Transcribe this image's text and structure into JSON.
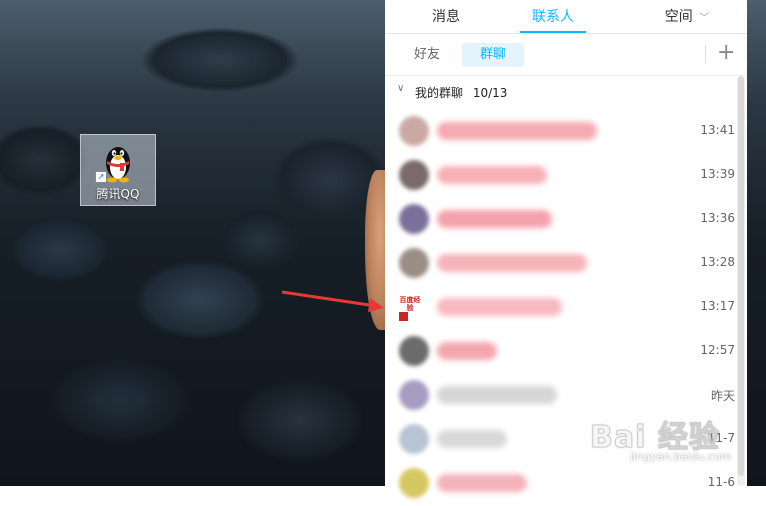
{
  "desktop": {
    "icon_label": "腾讯QQ"
  },
  "qq": {
    "tabs": [
      {
        "label": "消息",
        "active": false
      },
      {
        "label": "联系人",
        "active": true
      },
      {
        "label": "空间",
        "active": false
      }
    ],
    "subtabs": [
      {
        "label": "好友",
        "active": false
      },
      {
        "label": "群聊",
        "active": true
      }
    ],
    "group": {
      "title": "我的群聊",
      "count": "10/13"
    },
    "rows": [
      {
        "time": "13:41",
        "avatar_color": "#c9a9a3",
        "name_color": "#f5a9b0"
      },
      {
        "time": "13:39",
        "avatar_color": "#7a6a6a",
        "name_color": "#f7b0b6"
      },
      {
        "time": "13:36",
        "avatar_color": "#7c6f9a",
        "name_color": "#f4a2ad"
      },
      {
        "time": "13:28",
        "avatar_color": "#9b8e86",
        "name_color": "#f5b3b9"
      },
      {
        "time": "13:17",
        "avatar_color": "#ffffff",
        "name_color": "#f8b9c0",
        "avatar_text": "百度经验"
      },
      {
        "time": "12:57",
        "avatar_color": "#6b6b6b",
        "name_color": "#f3a6ae"
      },
      {
        "time": "昨天",
        "avatar_color": "#a79cc0",
        "name_color": "#d6d6d6"
      },
      {
        "time": "11-7",
        "avatar_color": "#b8c4d4",
        "name_color": "#d8d8d8"
      },
      {
        "time": "11-6",
        "avatar_color": "#d6c860",
        "name_color": "#f4b2ba"
      }
    ]
  },
  "watermark": {
    "main": "Bai 经验",
    "sub": "jingyan.baidu.com"
  },
  "colors": {
    "accent": "#12b7f5",
    "arrow": "#e53935"
  }
}
